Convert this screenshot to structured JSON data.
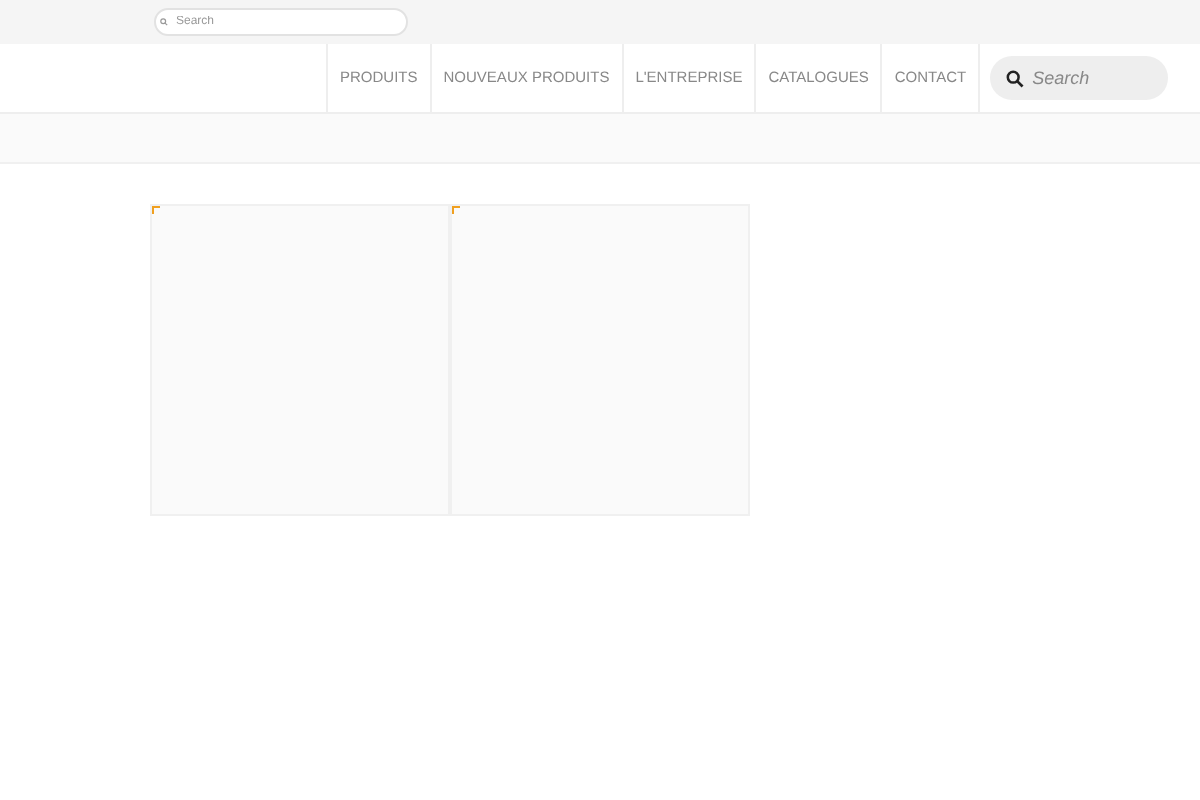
{
  "top_bar": {
    "search": {
      "placeholder": "Search"
    }
  },
  "nav": {
    "items": [
      {
        "label": "PRODUITS"
      },
      {
        "label": "NOUVEAUX PRODUITS"
      },
      {
        "label": "L'ENTREPRISE"
      },
      {
        "label": "CATALOGUES"
      },
      {
        "label": "CONTACT"
      }
    ],
    "search": {
      "placeholder": "Search"
    }
  },
  "cards": [
    {
      "kind": "empty"
    },
    {
      "kind": "empty"
    }
  ]
}
